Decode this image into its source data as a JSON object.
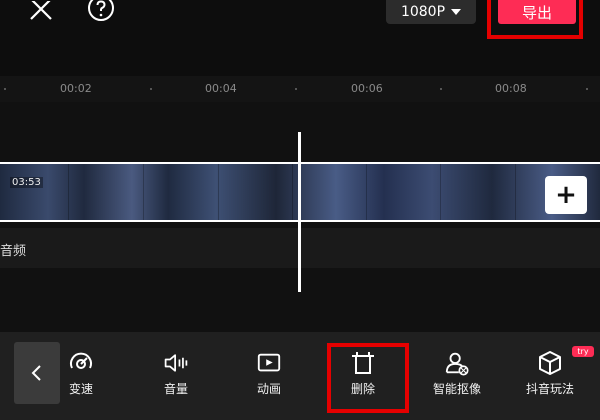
{
  "header": {
    "resolution_label": "1080P",
    "export_label": "导出"
  },
  "ruler": {
    "ticks": [
      "00:02",
      "00:04",
      "00:06",
      "00:08"
    ]
  },
  "timeline": {
    "clip_duration": "03:53",
    "add_clip_label": "+",
    "audio_label": "音频"
  },
  "toolbar": {
    "tools": [
      {
        "label": "变速",
        "icon": "speed-icon"
      },
      {
        "label": "音量",
        "icon": "volume-icon"
      },
      {
        "label": "动画",
        "icon": "animation-icon"
      },
      {
        "label": "删除",
        "icon": "delete-icon"
      },
      {
        "label": "智能抠像",
        "icon": "smart-cutout-icon"
      },
      {
        "label": "抖音玩法",
        "icon": "douyin-play-icon"
      }
    ],
    "try_badge": "try"
  },
  "colors": {
    "accent": "#fe2c55",
    "highlight_box": "#e50000",
    "background": "#0b0b0b"
  }
}
